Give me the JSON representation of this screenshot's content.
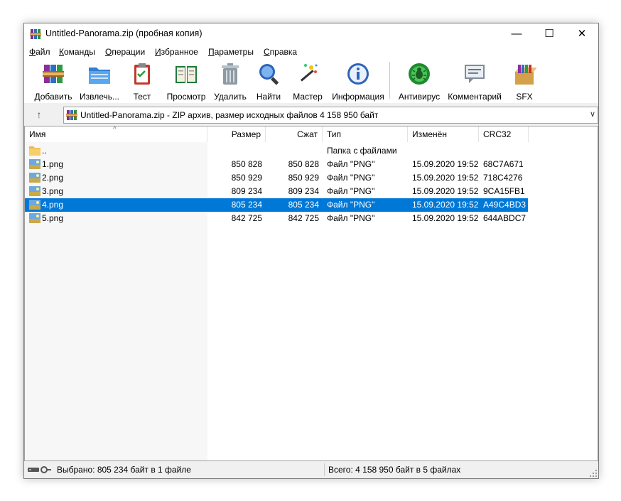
{
  "window": {
    "title": "Untitled-Panorama.zip (пробная копия)",
    "controls": {
      "minimize": "—",
      "maximize": "☐",
      "close": "✕"
    }
  },
  "menu": [
    "Файл",
    "Команды",
    "Операции",
    "Избранное",
    "Параметры",
    "Справка"
  ],
  "toolbar": {
    "add": "Добавить",
    "extract": "Извлечь...",
    "test": "Тест",
    "view": "Просмотр",
    "delete": "Удалить",
    "find": "Найти",
    "wizard": "Мастер",
    "info": "Информация",
    "antivirus": "Антивирус",
    "comment": "Комментарий",
    "sfx": "SFX"
  },
  "address": {
    "text": "Untitled-Panorama.zip - ZIP архив, размер исходных файлов 4 158 950 байт"
  },
  "columns": {
    "name": "Имя",
    "size": "Размер",
    "packed": "Сжат",
    "type": "Тип",
    "modified": "Изменён",
    "crc": "CRC32"
  },
  "rows": [
    {
      "name": "..",
      "size": "",
      "packed": "",
      "type": "Папка с файлами",
      "modified": "",
      "crc": "",
      "icon": "folder-icon"
    },
    {
      "name": "1.png",
      "size": "850 828",
      "packed": "850 828",
      "type": "Файл \"PNG\"",
      "modified": "15.09.2020 19:52",
      "crc": "68C7A671",
      "icon": "png-file-icon"
    },
    {
      "name": "2.png",
      "size": "850 929",
      "packed": "850 929",
      "type": "Файл \"PNG\"",
      "modified": "15.09.2020 19:52",
      "crc": "718C4276",
      "icon": "png-file-icon"
    },
    {
      "name": "3.png",
      "size": "809 234",
      "packed": "809 234",
      "type": "Файл \"PNG\"",
      "modified": "15.09.2020 19:52",
      "crc": "9CA15FB1",
      "icon": "png-file-icon"
    },
    {
      "name": "4.png",
      "size": "805 234",
      "packed": "805 234",
      "type": "Файл \"PNG\"",
      "modified": "15.09.2020 19:52",
      "crc": "A49C4BD3",
      "icon": "png-file-icon",
      "selected": true
    },
    {
      "name": "5.png",
      "size": "842 725",
      "packed": "842 725",
      "type": "Файл \"PNG\"",
      "modified": "15.09.2020 19:52",
      "crc": "644ABDC7",
      "icon": "png-file-icon"
    }
  ],
  "status": {
    "left": "Выбрано: 805 234 байт в 1 файле",
    "right": "Всего: 4 158 950 байт в 5 файлах"
  },
  "colors": {
    "selection": "#0078d7",
    "window_bg": "#f0f0f0"
  }
}
